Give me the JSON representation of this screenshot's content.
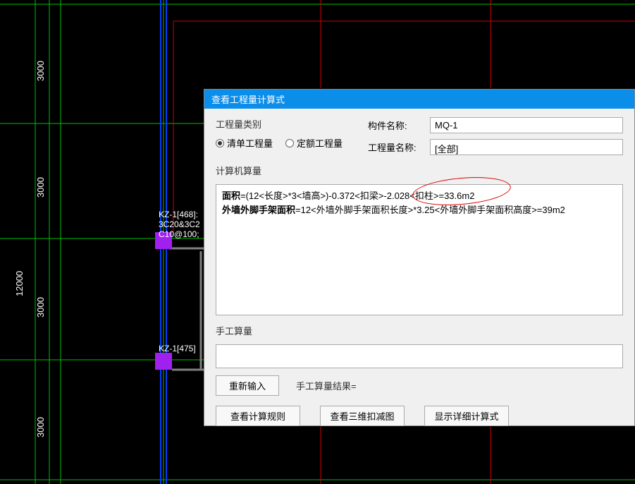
{
  "dialog": {
    "title": "查看工程量计算式",
    "type_label": "工程量类别",
    "radio_bill": "清单工程量",
    "radio_quota": "定额工程量",
    "component_label": "构件名称:",
    "component_value": "MQ-1",
    "qty_label": "工程量名称:",
    "qty_value": "[全部]",
    "calc_label": "计算机算量",
    "calc_line1_bold": "面积",
    "calc_line1_rest": "=(12<长度>*3<墙高>)-0.372<扣梁>-2.028<扣柱>=33.6m2",
    "calc_line2_bold": "外墙外脚手架面积",
    "calc_line2_rest": "=12<外墙外脚手架面积长度>*3.25<外墙外脚手架面积高度>=39m2",
    "manual_label": "手工算量",
    "btn_reinput": "重新输入",
    "result_label": "手工算量结果=",
    "btn_rule": "查看计算规则",
    "btn_3d": "查看三维扣减图",
    "btn_detail": "显示详细计算式"
  },
  "cad": {
    "dim_total": "12000",
    "dim_seg": "3000",
    "label1": "KZ-1[468]:",
    "label2": "3C20&3C2",
    "label3": "C10@100;",
    "label4": "KZ-1[475]"
  }
}
